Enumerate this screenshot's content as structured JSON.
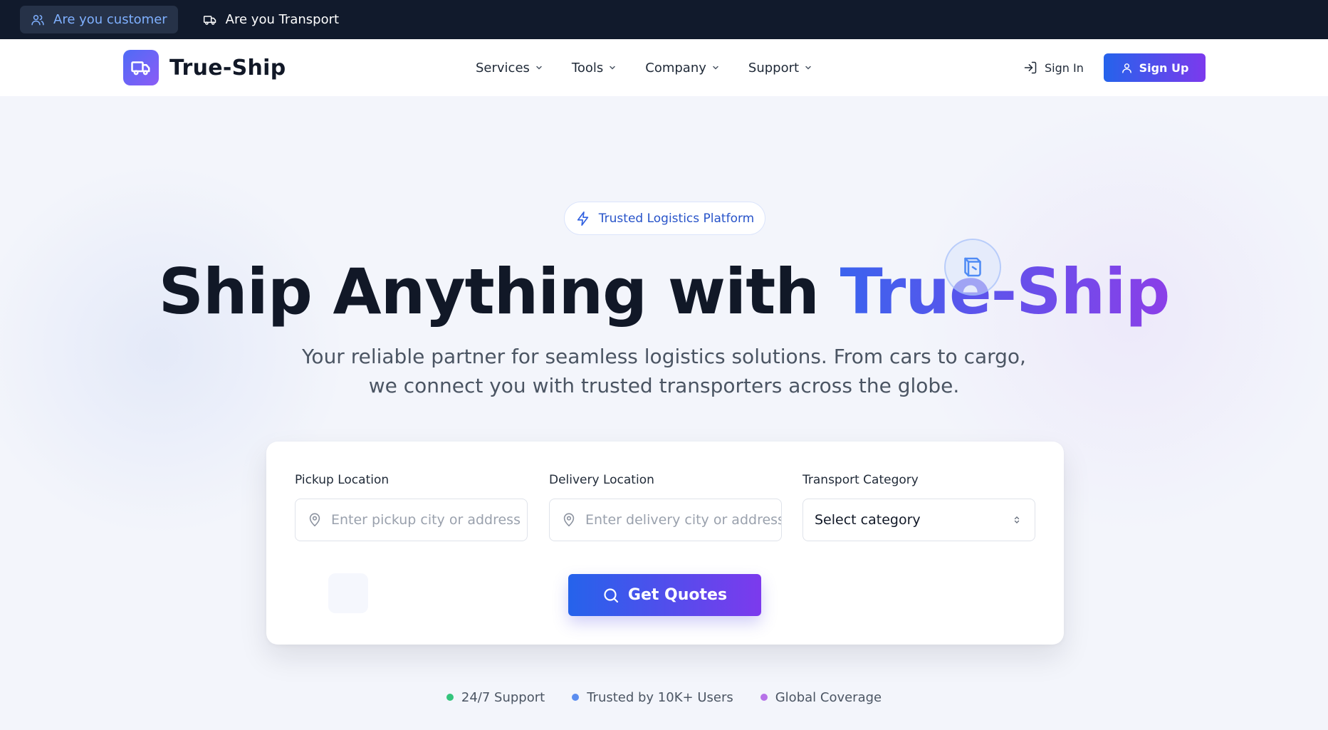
{
  "role_bar": {
    "tabs": [
      {
        "label": "Are you customer",
        "icon": "users-icon",
        "active": true
      },
      {
        "label": "Are you Transport",
        "icon": "truck-icon",
        "active": false
      }
    ]
  },
  "navbar": {
    "brand": {
      "name": "True-Ship",
      "logo_icon": "truck-icon"
    },
    "menu": [
      {
        "label": "Services"
      },
      {
        "label": "Tools"
      },
      {
        "label": "Company"
      },
      {
        "label": "Support"
      }
    ],
    "sign_in_label": "Sign In",
    "sign_up_label": "Sign Up"
  },
  "hero": {
    "badge": {
      "label": "Trusted Logistics Platform",
      "icon": "lightning-icon"
    },
    "headline_prefix": "Ship Anything with",
    "headline_highlight": "True-Ship",
    "subtitle_line1": "Your reliable partner for seamless logistics solutions. From cars to cargo,",
    "subtitle_line2": "we connect you with trusted transporters across the globe."
  },
  "search": {
    "pickup": {
      "label": "Pickup Location",
      "placeholder": "Enter pickup city or address",
      "value": "",
      "icon": "map-pin-icon"
    },
    "delivery": {
      "label": "Delivery Location",
      "placeholder": "Enter delivery city or address",
      "value": "",
      "icon": "map-pin-icon"
    },
    "category": {
      "label": "Transport Category",
      "selected": "Select category",
      "icon": "chevron-up-down-icon"
    },
    "submit_label": "Get Quotes"
  },
  "features": [
    {
      "label": "24/7 Support",
      "color": "#34c47c"
    },
    {
      "label": "Trusted by 10K+ Users",
      "color": "#5b8def"
    },
    {
      "label": "Global Coverage",
      "color": "#b672e8"
    }
  ],
  "colors": {
    "topbar_bg": "#111a2c",
    "accent_blue": "#2563eb",
    "accent_purple": "#7c3aed",
    "active_tab_text": "#7fb0ff"
  }
}
